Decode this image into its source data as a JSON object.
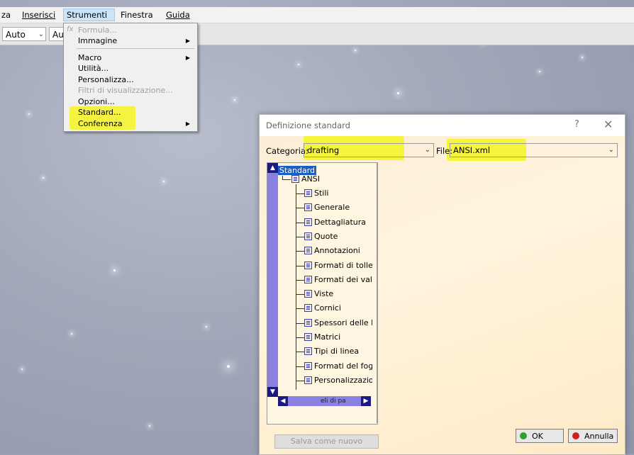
{
  "menubar": {
    "items": [
      {
        "label": "za"
      },
      {
        "label": "Inserisci"
      },
      {
        "label": "Strumenti"
      },
      {
        "label": "Finestra"
      },
      {
        "label": "Guida"
      }
    ]
  },
  "toolbar": {
    "combo1": "Auto",
    "combo2": "Au"
  },
  "tools_menu": {
    "items": [
      {
        "label": "Formula...",
        "enabled": false
      },
      {
        "label": "Immagine",
        "enabled": true,
        "submenu": true
      },
      {
        "label": "Macro",
        "enabled": true,
        "submenu": true
      },
      {
        "label": "Utilità...",
        "enabled": true
      },
      {
        "label": "Personalizza...",
        "enabled": true
      },
      {
        "label": "Filtri di visualizzazione...",
        "enabled": false
      },
      {
        "label": "Opzioni...",
        "enabled": true
      },
      {
        "label": "Standard...",
        "enabled": true,
        "highlighted": true
      },
      {
        "label": "Conferenza",
        "enabled": true,
        "submenu": true,
        "highlighted": true
      }
    ]
  },
  "dialog": {
    "title": "Definizione standard",
    "help": "?",
    "close": "✕",
    "categoria_label": "Categoria:",
    "categoria_value": "drafting",
    "file_label": "File:",
    "file_value": "ANSI.xml",
    "tree": {
      "root": "Standard",
      "ansi": "ANSI",
      "children": [
        "Stili",
        "Generale",
        "Dettagliatura",
        "Quote",
        "Annotazioni",
        "Formati di toller",
        "Formati dei valo",
        "Viste",
        "Cornici",
        "Spessori delle li",
        "Matrici",
        "Tipi di linea",
        "Formati del fogl",
        "Personalizzazior"
      ],
      "hscroll_text": "eli di pa"
    },
    "save_new": "Salva come nuovo",
    "ok": "OK",
    "cancel": "Annulla"
  },
  "colors": {
    "highlight": "#f5f521",
    "ok_dot": "#2ea02e",
    "cancel_dot": "#d02020",
    "selection": "#1a5fc8"
  }
}
